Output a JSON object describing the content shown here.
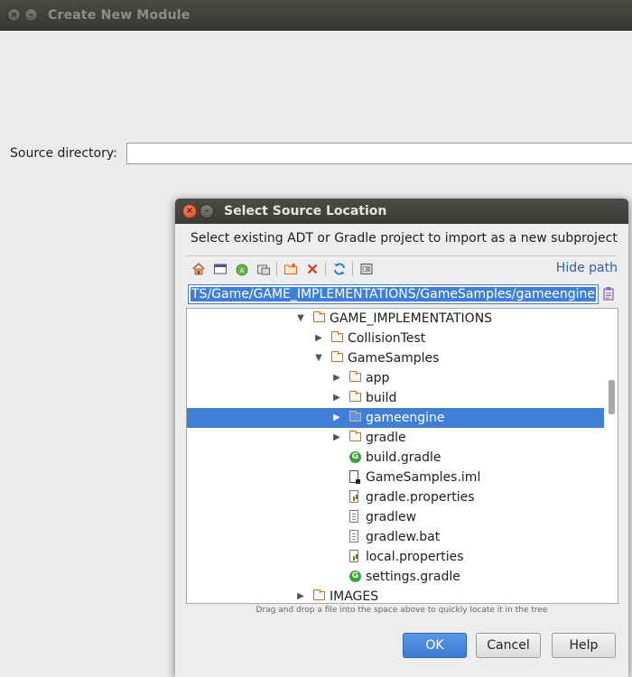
{
  "main_window": {
    "title": "Create New Module",
    "close_glyph": "×",
    "minimize_glyph": "–",
    "source_directory_label": "Source directory:",
    "source_directory_value": ""
  },
  "dialog": {
    "title": "Select Source Location",
    "description": "Select existing ADT or Gradle project to import as a new subproject",
    "hide_path_label": "Hide path",
    "path_value": "TS/Game/GAME_IMPLEMENTATIONS/GameSamples/gameengine",
    "toolbar_icons": [
      "home-icon",
      "desktop-icon",
      "project-icon",
      "module-icon",
      "new-folder-icon",
      "delete-icon",
      "refresh-icon",
      "show-hidden-icon"
    ],
    "tree": [
      {
        "label": "GAME_IMPLEMENTATIONS",
        "icon": "folder",
        "arrow": "▼",
        "selected": false
      },
      {
        "label": "CollisionTest",
        "icon": "folder",
        "arrow": "▶",
        "selected": false
      },
      {
        "label": "GameSamples",
        "icon": "folder",
        "arrow": "▼",
        "selected": false
      },
      {
        "label": "app",
        "icon": "folder",
        "arrow": "▶",
        "selected": false
      },
      {
        "label": "build",
        "icon": "folder",
        "arrow": "▶",
        "selected": false
      },
      {
        "label": "gameengine",
        "icon": "folder",
        "arrow": "▶",
        "selected": true
      },
      {
        "label": "gradle",
        "icon": "folder",
        "arrow": "▶",
        "selected": false
      },
      {
        "label": "build.gradle",
        "icon": "gradle",
        "arrow": "",
        "selected": false
      },
      {
        "label": "GameSamples.iml",
        "icon": "iml",
        "arrow": "",
        "selected": false
      },
      {
        "label": "gradle.properties",
        "icon": "properties",
        "arrow": "",
        "selected": false
      },
      {
        "label": "gradlew",
        "icon": "file",
        "arrow": "",
        "selected": false
      },
      {
        "label": "gradlew.bat",
        "icon": "file",
        "arrow": "",
        "selected": false
      },
      {
        "label": "local.properties",
        "icon": "properties",
        "arrow": "",
        "selected": false
      },
      {
        "label": "settings.gradle",
        "icon": "gradle",
        "arrow": "",
        "selected": false
      },
      {
        "label": "IMAGES",
        "icon": "folder",
        "arrow": "▶",
        "selected": false
      }
    ],
    "hint": "Drag and drop a file into the space above to quickly locate it in the tree",
    "buttons": {
      "ok": "OK",
      "cancel": "Cancel",
      "help": "Help"
    },
    "colors": {
      "selection": "#3f7fd8",
      "ok_button": "#3d7bd6",
      "link": "#2f5fa8",
      "close_button": "#e0522a"
    }
  }
}
